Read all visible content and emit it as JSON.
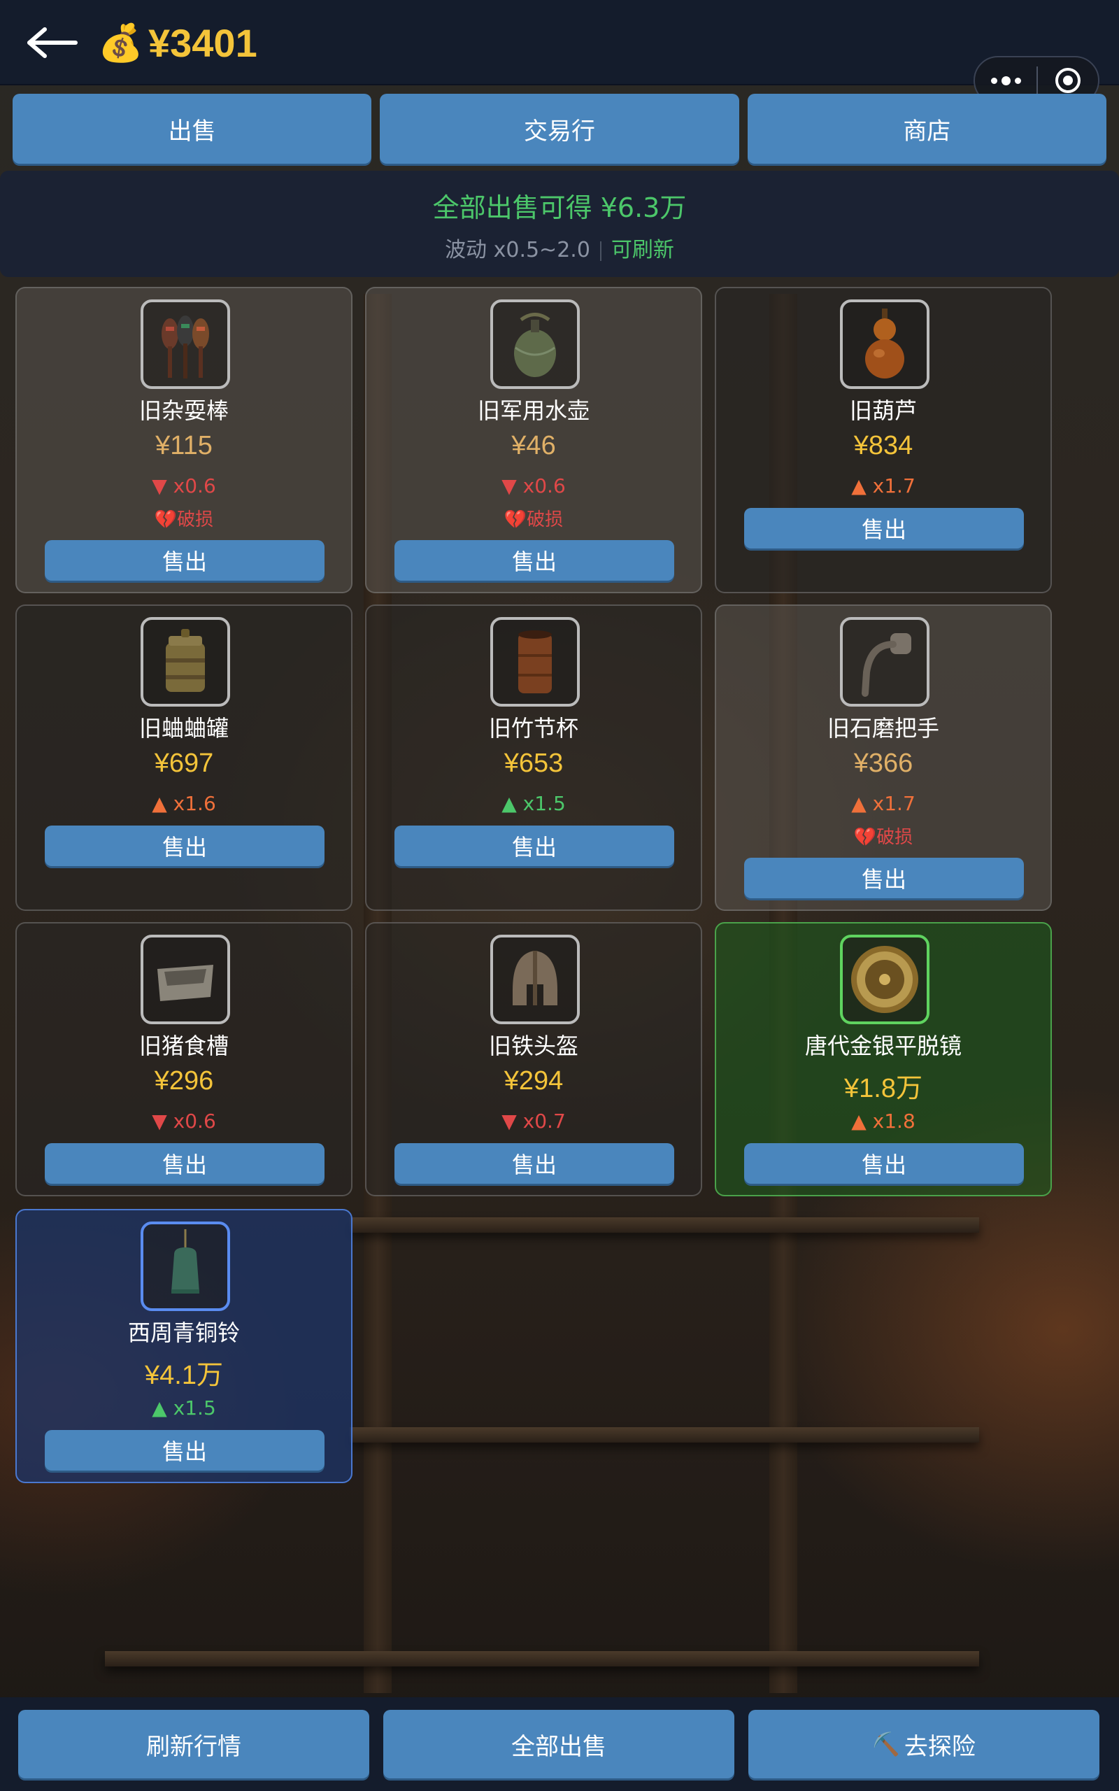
{
  "header": {
    "balance": "¥3401",
    "coin_icon": "money-bag-icon",
    "back_icon": "arrow-left-icon"
  },
  "tabs": [
    {
      "label": "出售"
    },
    {
      "label": "交易行"
    },
    {
      "label": "商店"
    }
  ],
  "summary": {
    "total_text": "全部出售可得 ¥6.3万",
    "fluctuation_text": "波动 x0.5~2.0",
    "refresh_text": "可刷新"
  },
  "items": [
    {
      "name": "旧杂耍棒",
      "price": "¥115",
      "mult": "▼ x0.6",
      "status": "💔破损",
      "sell_label": "售出"
    },
    {
      "name": "旧军用水壶",
      "price": "¥46",
      "mult": "▼ x0.6",
      "status": "💔破损",
      "sell_label": "售出"
    },
    {
      "name": "旧葫芦",
      "price": "¥834",
      "mult": "▲ x1.7",
      "sell_label": "售出"
    },
    {
      "name": "旧蛐蛐罐",
      "price": "¥697",
      "mult": "▲ x1.6",
      "sell_label": "售出"
    },
    {
      "name": "旧竹节杯",
      "price": "¥653",
      "mult": "▲ x1.5",
      "sell_label": "售出"
    },
    {
      "name": "旧石磨把手",
      "price": "¥366",
      "mult": "▲ x1.7",
      "status": "💔破损",
      "sell_label": "售出"
    },
    {
      "name": "旧猪食槽",
      "price": "¥296",
      "mult": "▼ x0.6",
      "sell_label": "售出"
    },
    {
      "name": "旧铁头盔",
      "price": "¥294",
      "mult": "▼ x0.7",
      "sell_label": "售出"
    },
    {
      "name": "唐代金银平脱镜",
      "price": "¥1.8万",
      "mult": "▲ x1.8",
      "sell_label": "售出"
    },
    {
      "name": "西周青铜铃",
      "price": "¥4.1万",
      "mult": "▲ x1.5",
      "sell_label": "售出"
    }
  ],
  "bottom": {
    "refresh_label": "刷新行情",
    "sell_all_label": "全部出售",
    "explore_label": "去探险",
    "explore_icon": "⛏️"
  },
  "colors": {
    "accent_blue": "#4a86bd",
    "gold": "#f4c43a",
    "green": "#4cc76a",
    "red": "#e04848"
  }
}
